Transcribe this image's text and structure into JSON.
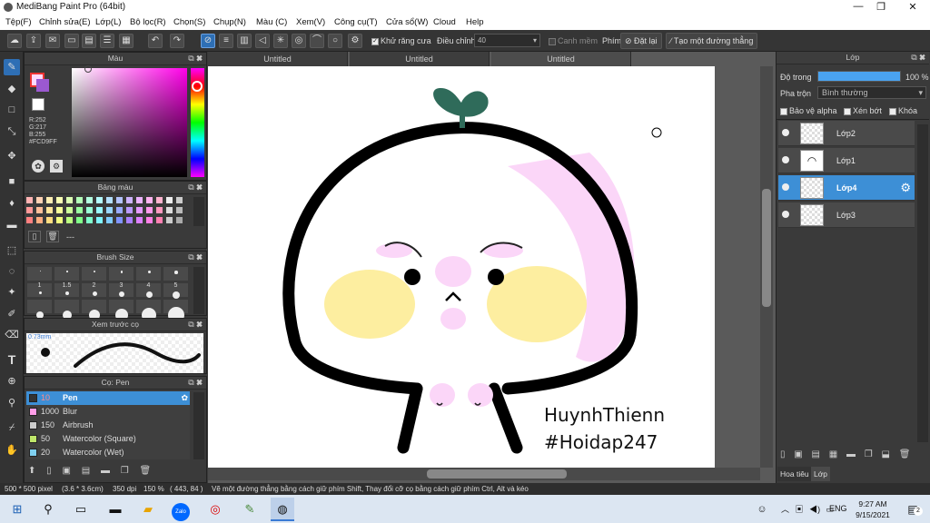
{
  "app": {
    "title": "MediBang Paint Pro (64bit)"
  },
  "window_controls": {
    "minimize": "—",
    "maximize": "❐",
    "close": "✕"
  },
  "menu": [
    "Tệp(F)",
    "Chỉnh sửa(E)",
    "Lớp(L)",
    "Bộ lọc(R)",
    "Chọn(S)",
    "Chụp(N)",
    "Màu (C)",
    "Xem(V)",
    "Công cụ(T)",
    "Cửa sổ(W)",
    "Cloud",
    "Help"
  ],
  "toolbar": {
    "antialias_label": "Khử răng cưa",
    "adjust_label": "Điều chỉnh",
    "adjust_value": "40",
    "clean_edge_label": "Canh mềm",
    "key_label": "Phím",
    "change_label": "Đặt lại",
    "straight_line_label": "Tạo một đường thẳng"
  },
  "color_panel": {
    "title": "Màu",
    "r": "R:252",
    "g": "G:217",
    "b": "B:255",
    "hex": "#FCD9FF",
    "primary_color": "#FCD9FF",
    "secondary_color": "#9B59D0"
  },
  "palette_panel": {
    "title": "Bảng màu",
    "footer_text": "---",
    "colors": [
      "#ffb3b3",
      "#ffd1b3",
      "#ffeeb3",
      "#f9ffb3",
      "#dcffb3",
      "#b3ffb8",
      "#b3ffe0",
      "#b3fbff",
      "#b3e0ff",
      "#b3c3ff",
      "#cdb3ff",
      "#ecb3ff",
      "#ffb3f0",
      "#ffb3cf",
      "#eeeeee",
      "#cccccc",
      "#ff9999",
      "#ffbf99",
      "#ffe699",
      "#f5ff99",
      "#ccff99",
      "#99ffa0",
      "#99ffd6",
      "#99f8ff",
      "#99d6ff",
      "#99aaff",
      "#bb99ff",
      "#e599ff",
      "#ff99eb",
      "#ff99c0",
      "#dddddd",
      "#bbbbbb",
      "#ff8080",
      "#ffad80",
      "#ffdd80",
      "#f2ff80",
      "#bbff80",
      "#80ff88",
      "#80ffcc",
      "#80f5ff",
      "#80ccff",
      "#8094ff",
      "#aa80ff",
      "#dd80ff",
      "#ff80e6",
      "#ff80b2",
      "#cccccc",
      "#aaaaaa"
    ]
  },
  "brush_size_panel": {
    "title": "Brush Size",
    "sizes": [
      "1",
      "1.5",
      "2",
      "3",
      "4",
      "5"
    ]
  },
  "preview_panel": {
    "title": "Xem trước cọ",
    "size_label": "0.73mm"
  },
  "brush_panel": {
    "title": "Cọ: Pen",
    "brushes": [
      {
        "size": "10",
        "name": "Pen",
        "color": "#333333"
      },
      {
        "size": "1000",
        "name": "Blur",
        "color": "#ff9ee8"
      },
      {
        "size": "150",
        "name": "Airbrush",
        "color": "#cccccc"
      },
      {
        "size": "50",
        "name": "Watercolor (Square)",
        "color": "#bfe66a"
      },
      {
        "size": "20",
        "name": "Watercolor (Wet)",
        "color": "#7fd0f0"
      }
    ]
  },
  "doc_tabs": [
    "Untitled",
    "Untitled",
    "Untitled"
  ],
  "canvas": {
    "signature_line1": "HuynhThienn",
    "signature_line2": "#Hoidap247"
  },
  "layer_panel": {
    "title": "Lớp",
    "opacity_label": "Độ trong",
    "opacity_value": "100 %",
    "opacity": 1.0,
    "blend_label": "Pha trộn",
    "blend_value": "Bình thường",
    "protect_alpha": "Bảo vệ alpha",
    "clipping": "Xén bớt",
    "lock": "Khóa",
    "layers": [
      "Lớp2",
      "Lớp1",
      "Lớp4",
      "Lớp3"
    ],
    "selected_layer": "Lớp4",
    "bottom_tabs": [
      "Hoa tiêu",
      "Lớp"
    ]
  },
  "status": {
    "size": "500 * 500 pixel",
    "dims": "(3.6 * 3.6cm)",
    "dpi": "350 dpi",
    "zoom": "150 %",
    "pos": "( 443, 84 )",
    "hint": "Vẽ một đường thẳng bằng cách giữ phím Shift, Thay đổi cỡ cọ bằng cách giữ phím Ctrl, Alt và kéo"
  },
  "taskbar": {
    "lang": "ENG",
    "time": "9:27 AM",
    "date": "9/15/2021",
    "notif_count": "2",
    "zalo": "Zalo"
  }
}
